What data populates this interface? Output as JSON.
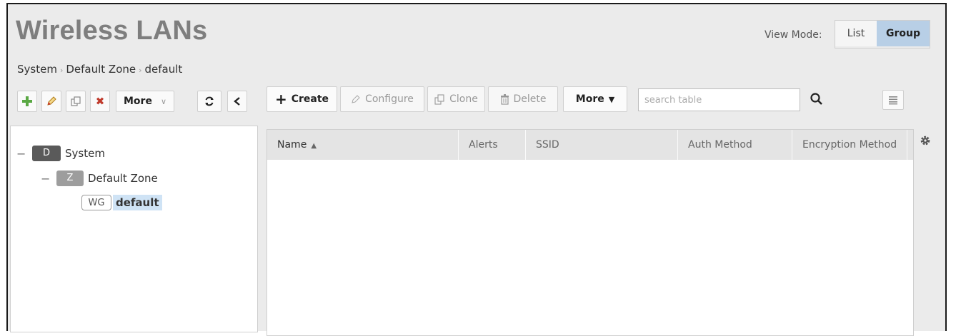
{
  "page": {
    "title": "Wireless LANs",
    "view_mode_label": "View Mode:",
    "view_modes": [
      "List",
      "Group"
    ],
    "active_view_mode": "Group"
  },
  "breadcrumb": [
    "System",
    "Default Zone",
    "default"
  ],
  "left_toolbar": {
    "more_label": "More"
  },
  "toolbar": {
    "create": "Create",
    "configure": "Configure",
    "clone": "Clone",
    "delete": "Delete",
    "more": "More",
    "search_placeholder": "search table"
  },
  "tree": {
    "system": {
      "badge": "D",
      "label": "System"
    },
    "zone": {
      "badge": "Z",
      "label": "Default Zone"
    },
    "group": {
      "badge": "WG",
      "label": "default"
    }
  },
  "table": {
    "columns": [
      "Name",
      "Alerts",
      "SSID",
      "Auth Method",
      "Encryption Method"
    ],
    "rows": []
  },
  "colors": {
    "accent_selected": "#b8cfe6",
    "add_green": "#5aa844",
    "delete_red": "#c0392b"
  }
}
